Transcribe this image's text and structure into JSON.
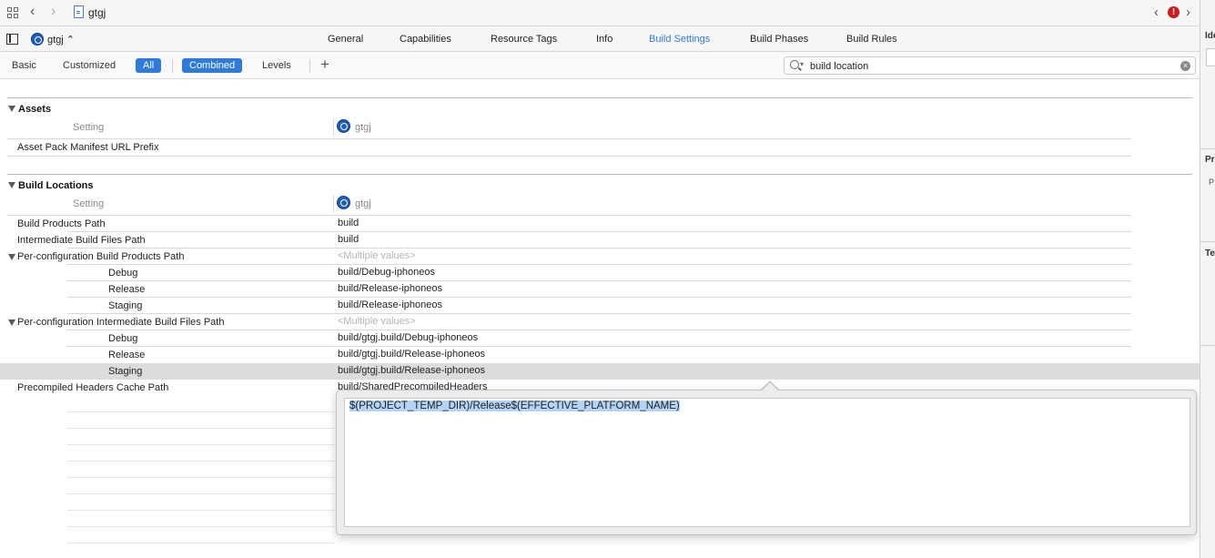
{
  "jumpbar": {
    "title": "gtgj"
  },
  "tabbar": {
    "project": "gtgj",
    "tabs": [
      {
        "label": "General",
        "active": false
      },
      {
        "label": "Capabilities",
        "active": false
      },
      {
        "label": "Resource Tags",
        "active": false
      },
      {
        "label": "Info",
        "active": false
      },
      {
        "label": "Build Settings",
        "active": true
      },
      {
        "label": "Build Phases",
        "active": false
      },
      {
        "label": "Build Rules",
        "active": false
      }
    ]
  },
  "filterbar": {
    "basic": "Basic",
    "customized": "Customized",
    "all": "All",
    "combined": "Combined",
    "levels": "Levels",
    "plus": "+",
    "search_value": "build location"
  },
  "sections": {
    "assets": {
      "title": "Assets",
      "setting_header": "Setting",
      "target": "gtgj",
      "rows": [
        {
          "name": "Asset Pack Manifest URL Prefix",
          "value": ""
        }
      ]
    },
    "build_locations": {
      "title": "Build Locations",
      "setting_header": "Setting",
      "target": "gtgj",
      "rows": [
        {
          "name": "Build Products Path",
          "value": "build"
        },
        {
          "name": "Intermediate Build Files Path",
          "value": "build"
        },
        {
          "name": "Per-configuration Build Products Path",
          "value": "<Multiple values>"
        },
        {
          "name": "Debug",
          "value": "build/Debug-iphoneos"
        },
        {
          "name": "Release",
          "value": "build/Release-iphoneos"
        },
        {
          "name": "Staging",
          "value": "build/Release-iphoneos"
        },
        {
          "name": "Per-configuration Intermediate Build Files Path",
          "value": "<Multiple values>"
        },
        {
          "name": "Debug",
          "value": "build/gtgj.build/Debug-iphoneos"
        },
        {
          "name": "Release",
          "value": "build/gtgj.build/Release-iphoneos"
        },
        {
          "name": "Staging",
          "value": "build/gtgj.build/Release-iphoneos"
        },
        {
          "name": "Precompiled Headers Cache Path",
          "value": "build/SharedPrecompiledHeaders"
        }
      ]
    }
  },
  "popover": {
    "text": "$(PROJECT_TEMP_DIR)/Release$(EFFECTIVE_PLATFORM_NAME)"
  },
  "inspector": {
    "label1": "Ide",
    "label2": "Pr",
    "sub2": "P",
    "label3": "Te"
  },
  "colors": {
    "accent": "#2f7bdc",
    "selected_row": "#dcdcdc",
    "error": "#d0191c"
  }
}
